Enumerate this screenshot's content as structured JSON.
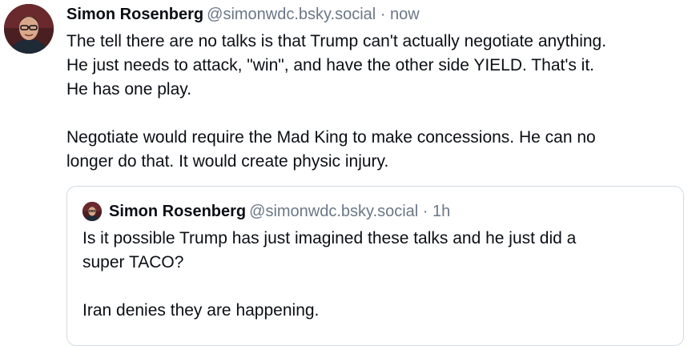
{
  "post": {
    "author": {
      "name": "Simon Rosenberg",
      "handle": "@simonwdc.bsky.social"
    },
    "separator": " · ",
    "time": "now",
    "paragraphs": [
      "The tell there are no talks is that Trump can't actually negotiate anything.\nHe just needs to attack, \"win\", and have the other side YIELD.  That's it.\nHe has one play.",
      "Negotiate would require the Mad King to make concessions.  He can no\nlonger do that.  It would create physic injury."
    ]
  },
  "quoted_post": {
    "author": {
      "name": "Simon Rosenberg",
      "handle": "@simonwdc.bsky.social"
    },
    "separator": " · ",
    "time": "1h",
    "paragraphs": [
      "Is it possible Trump has just imagined these talks and he just did a\nsuper TACO?",
      "Iran denies they are happening."
    ]
  },
  "colors": {
    "text": "#0b0f14",
    "muted": "#6b7787",
    "border": "#d4dbe2"
  }
}
